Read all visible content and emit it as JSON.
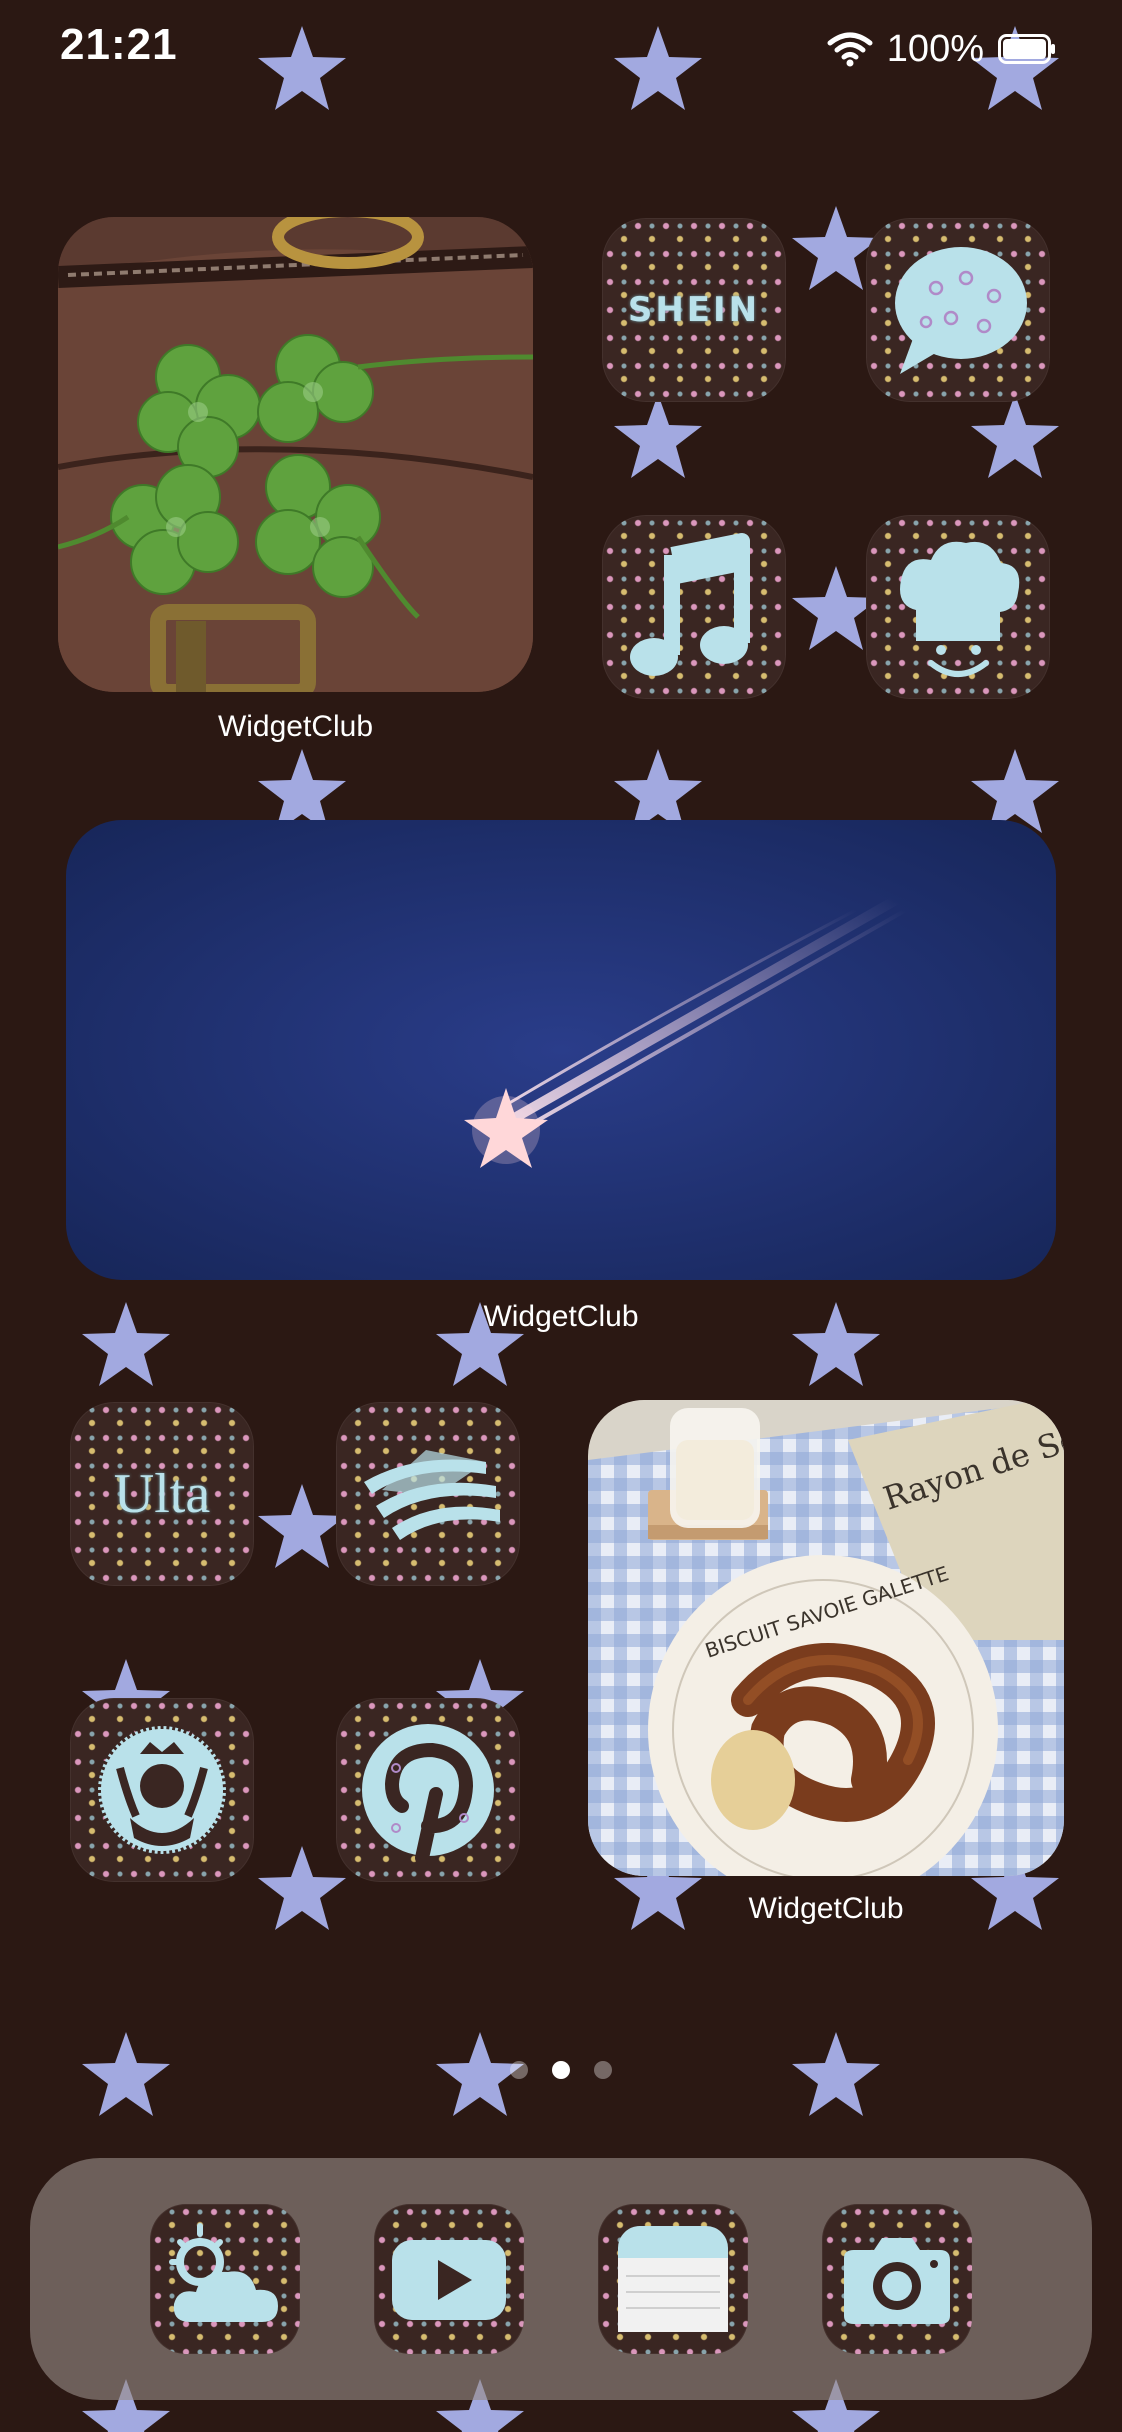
{
  "status_bar": {
    "time": "21:21",
    "battery": "100%"
  },
  "home": {
    "widgets": [
      {
        "caption": "WidgetClub",
        "photo": "four-leaf-clovers-on-leather-bag"
      },
      {
        "caption": "WidgetClub",
        "photo": "shooting-star-on-blue-sky"
      },
      {
        "caption": "WidgetClub",
        "photo": "pretzel-and-milk-on-gingham",
        "plate_text": "BISCUIT SAVOIE GALETTE",
        "book_text": "Rayon de Soleil"
      }
    ],
    "apps": [
      {
        "name": "shein-app",
        "label": "SHEIN"
      },
      {
        "name": "messages-app",
        "icon": "speech-bubble-icon"
      },
      {
        "name": "music-app",
        "icon": "music-note-icon"
      },
      {
        "name": "toy-story-app",
        "icon": "chef-hat-face-icon"
      },
      {
        "name": "ulta-app",
        "label": "Ulta"
      },
      {
        "name": "bank-app",
        "icon": "bank-flag-icon"
      },
      {
        "name": "starbucks-app",
        "icon": "siren-icon"
      },
      {
        "name": "pinterest-app",
        "icon": "pinterest-icon"
      }
    ],
    "page_dots": {
      "count": 3,
      "active": 1
    }
  },
  "dock": {
    "apps": [
      {
        "name": "weather-app",
        "icon": "sun-cloud-icon"
      },
      {
        "name": "youtube-app",
        "icon": "play-icon"
      },
      {
        "name": "notes-app",
        "icon": "notepad-icon"
      },
      {
        "name": "camera-app",
        "icon": "camera-icon"
      }
    ]
  },
  "colors": {
    "wallpaper": "#2b1813",
    "star": "#a2a9e0",
    "icon_glyph": "#b9e1ea",
    "dock": "#968a86"
  }
}
